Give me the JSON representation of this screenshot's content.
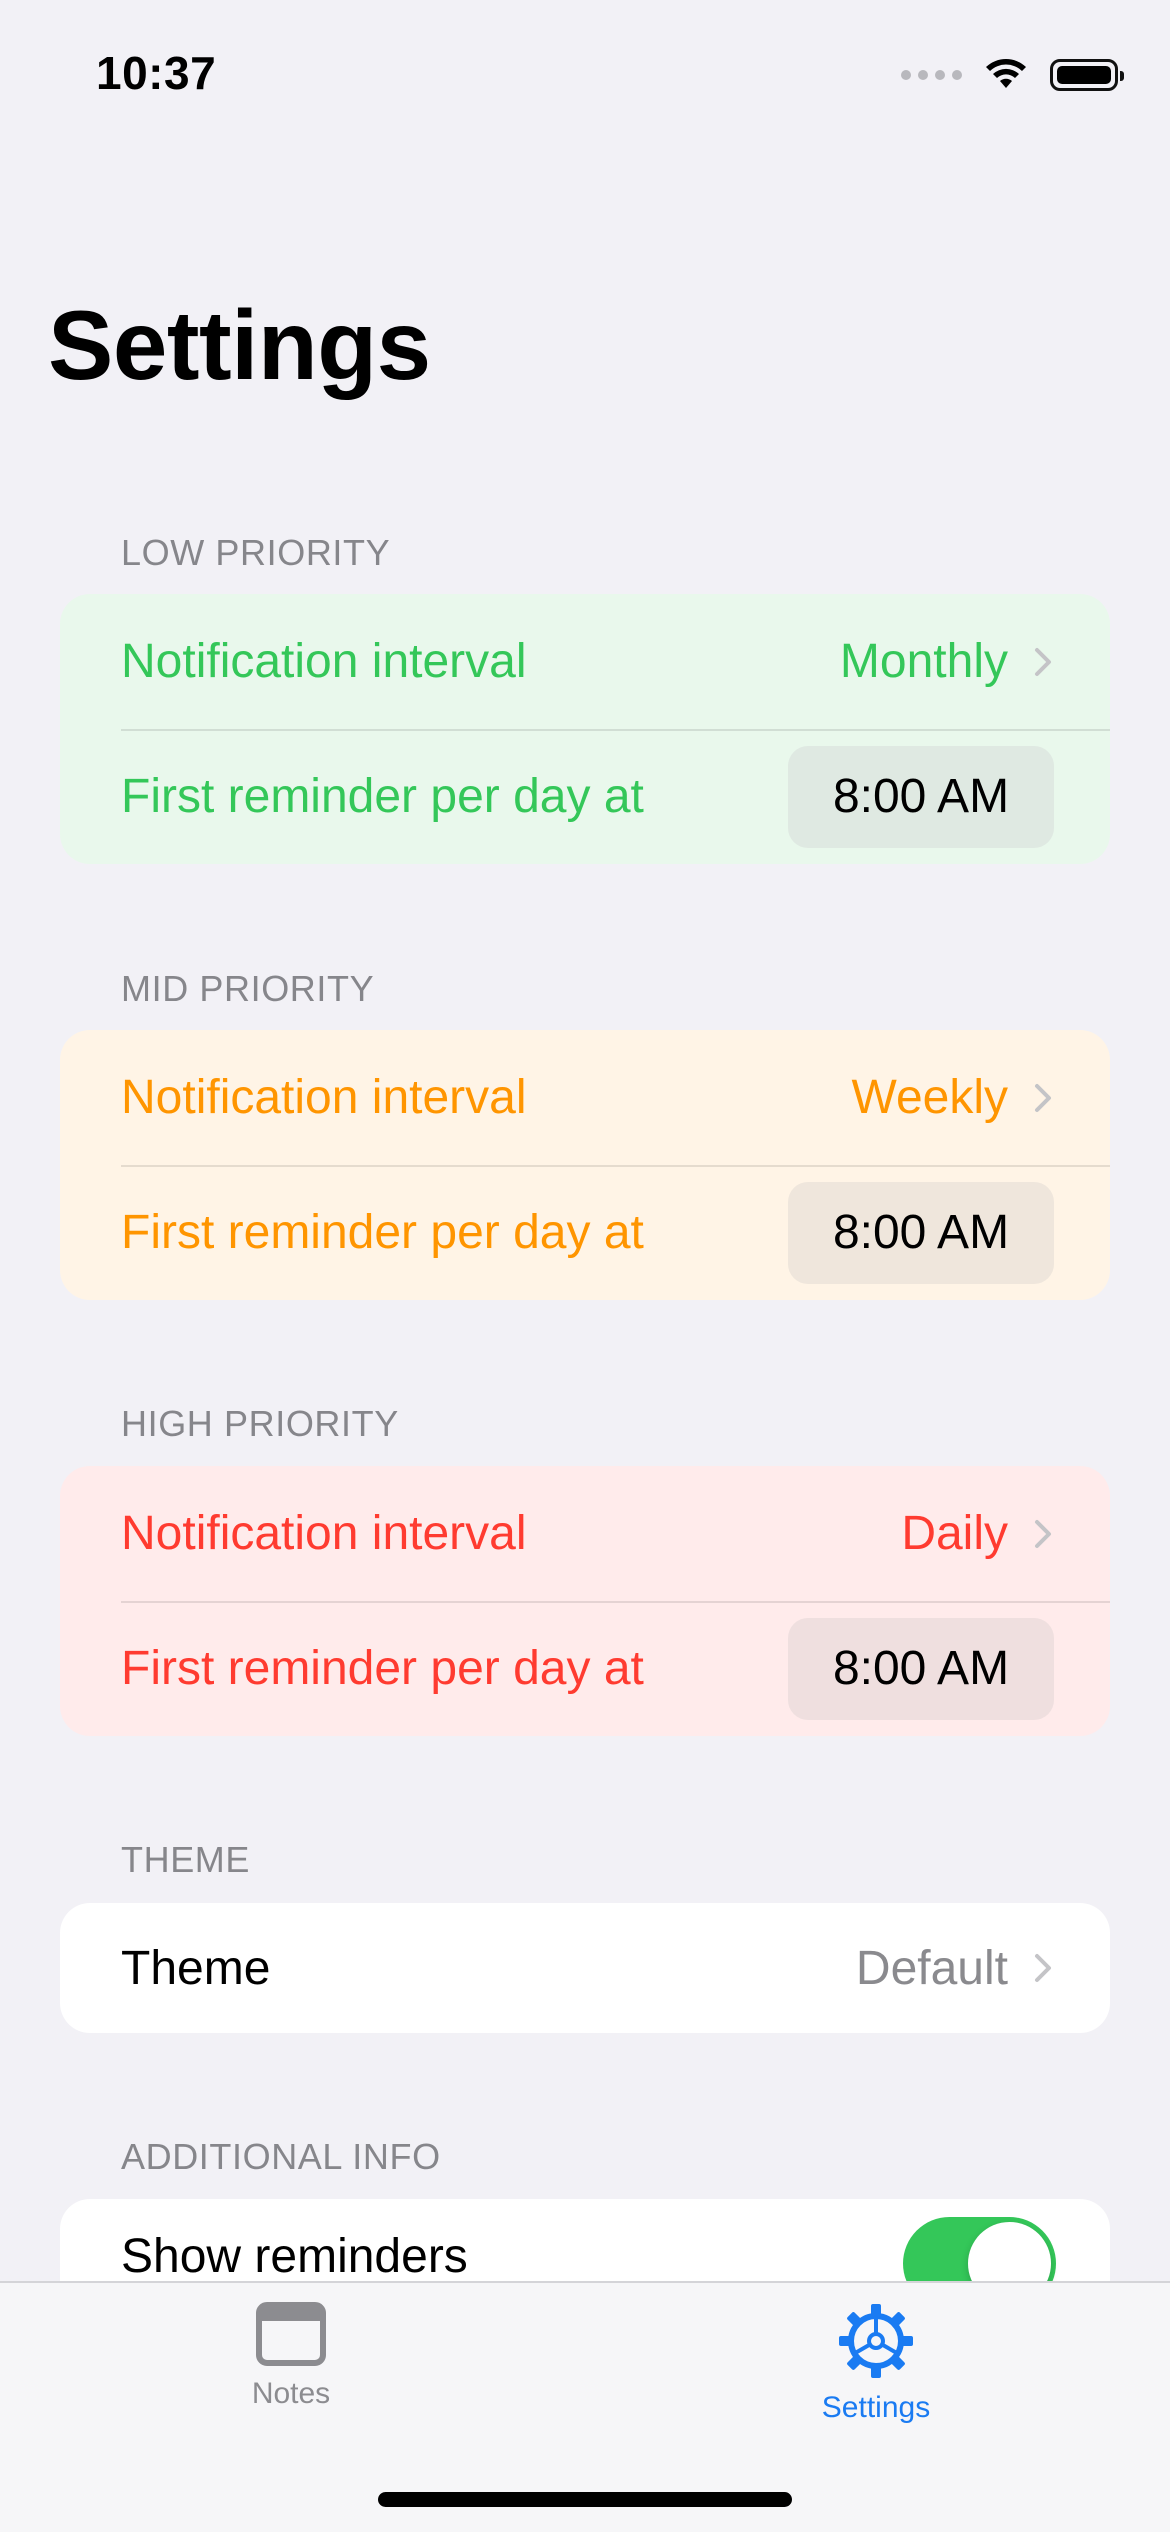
{
  "status_bar": {
    "time": "10:37"
  },
  "page": {
    "title": "Settings"
  },
  "colors": {
    "low": "#34c759",
    "low_bg": "#e9f8ec",
    "low_chip": "#dfe9e2",
    "mid": "#ff9500",
    "mid_bg": "#fff4e6",
    "mid_chip": "#efe6dc",
    "high": "#ff3b30",
    "high_bg": "#ffebeb",
    "high_chip": "#efdfdf",
    "accent": "#1a7bf2",
    "switch_on": "#34c759"
  },
  "sections": {
    "low": {
      "header": "LOW PRIORITY",
      "interval_label": "Notification interval",
      "interval_value": "Monthly",
      "reminder_label": "First reminder per day at",
      "reminder_time": "8:00 AM"
    },
    "mid": {
      "header": "MID PRIORITY",
      "interval_label": "Notification interval",
      "interval_value": "Weekly",
      "reminder_label": "First reminder per day at",
      "reminder_time": "8:00 AM"
    },
    "high": {
      "header": "HIGH PRIORITY",
      "interval_label": "Notification interval",
      "interval_value": "Daily",
      "reminder_label": "First reminder per day at",
      "reminder_time": "8:00 AM"
    },
    "theme": {
      "header": "THEME",
      "label": "Theme",
      "value": "Default"
    },
    "additional": {
      "header": "ADDITIONAL INFO",
      "show_reminders_label": "Show reminders",
      "show_reminders_on": true
    }
  },
  "tab_bar": {
    "tabs": [
      {
        "label": "Notes",
        "icon": "window-icon",
        "selected": false
      },
      {
        "label": "Settings",
        "icon": "gear-icon",
        "selected": true
      }
    ]
  }
}
